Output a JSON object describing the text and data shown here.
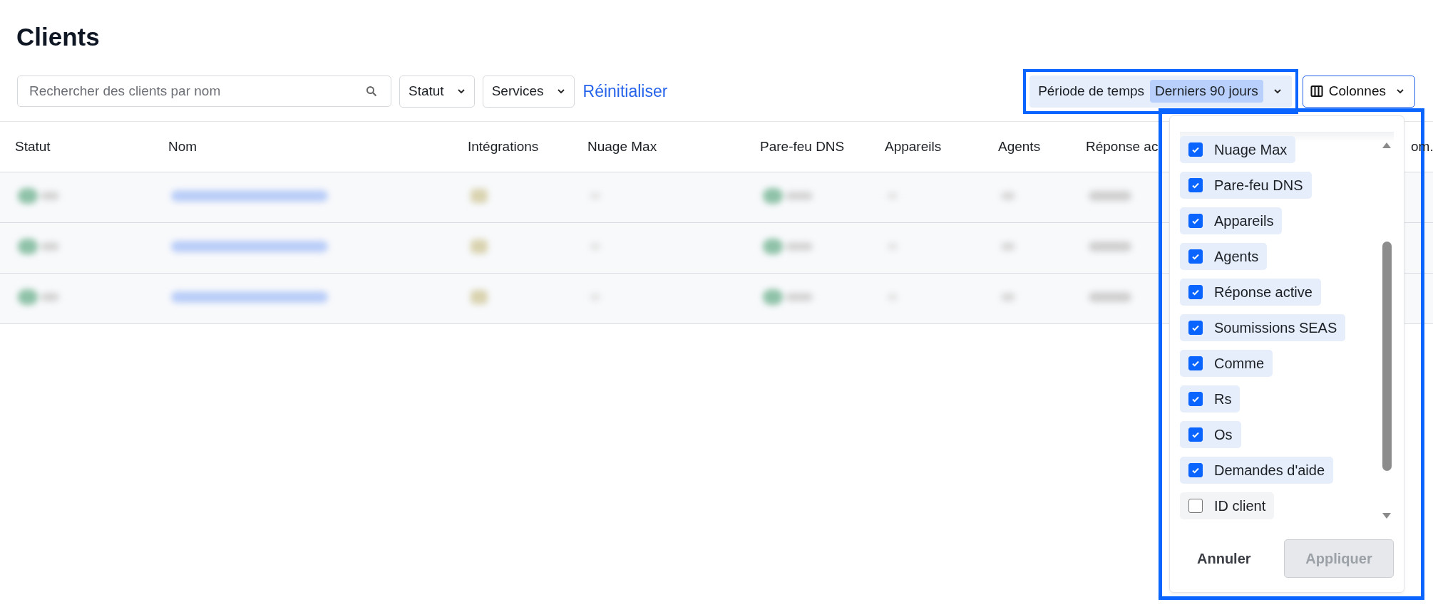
{
  "title": "Clients",
  "toolbar": {
    "search": {
      "placeholder": "Rechercher des clients par nom"
    },
    "filters": [
      {
        "label": "Statut"
      },
      {
        "label": "Services"
      }
    ],
    "reset": "Réinitialiser",
    "period": {
      "label": "Période de temps",
      "value": "Derniers 90 jours",
      "outlined": true
    },
    "columns_button": {
      "label": "Colonnes",
      "open": true
    }
  },
  "table": {
    "columns": [
      {
        "label": "Statut"
      },
      {
        "label": "Nom"
      },
      {
        "label": "Intégrations"
      },
      {
        "label": "Nuage Max"
      },
      {
        "label": "Pare-feu DNS"
      },
      {
        "label": "Appareils"
      },
      {
        "label": "Agents"
      },
      {
        "label": "Réponse ac"
      },
      {
        "label": "om."
      }
    ],
    "rows": [
      {
        "kind": "blurred"
      },
      {
        "kind": "blurred"
      },
      {
        "kind": "blurred"
      }
    ]
  },
  "columns_menu": {
    "outlined": true,
    "items": [
      {
        "label": "Nuage Max",
        "checked": true
      },
      {
        "label": "Pare-feu DNS",
        "checked": true
      },
      {
        "label": "Appareils",
        "checked": true
      },
      {
        "label": "Agents",
        "checked": true
      },
      {
        "label": "Réponse active",
        "checked": true
      },
      {
        "label": "Soumissions SEAS",
        "checked": true
      },
      {
        "label": "Comme",
        "checked": true
      },
      {
        "label": "Rs",
        "checked": true
      },
      {
        "label": "Os",
        "checked": true
      },
      {
        "label": "Demandes d'aide",
        "checked": true
      },
      {
        "label": "ID client",
        "checked": false
      }
    ],
    "cancel": "Annuler",
    "apply": {
      "label": "Appliquer",
      "disabled": true
    }
  }
}
